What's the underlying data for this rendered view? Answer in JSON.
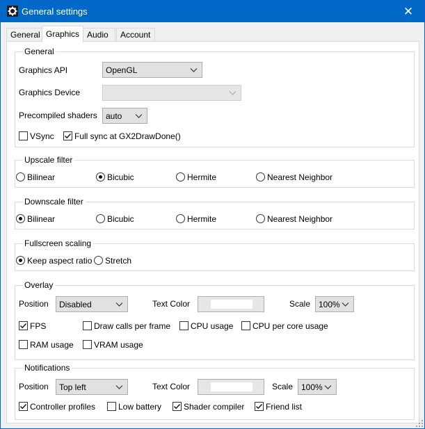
{
  "window": {
    "title": "General settings",
    "app_icon": "gear-icon",
    "close_glyph": "✕"
  },
  "tabs": [
    {
      "label": "General",
      "active": false
    },
    {
      "label": "Graphics",
      "active": true
    },
    {
      "label": "Audio",
      "active": false
    },
    {
      "label": "Account",
      "active": false
    }
  ],
  "general": {
    "title": "General",
    "api_label": "Graphics API",
    "api_value": "OpenGL",
    "device_label": "Graphics Device",
    "device_value": "",
    "shaders_label": "Precompiled shaders",
    "shaders_value": "auto",
    "vsync_label": "VSync",
    "vsync_checked": false,
    "fullsync_label": "Full sync at GX2DrawDone()",
    "fullsync_checked": true
  },
  "upscale": {
    "title": "Upscale filter",
    "options": [
      "Bilinear",
      "Bicubic",
      "Hermite",
      "Nearest Neighbor"
    ],
    "selected": "Bicubic"
  },
  "downscale": {
    "title": "Downscale filter",
    "options": [
      "Bilinear",
      "Bicubic",
      "Hermite",
      "Nearest Neighbor"
    ],
    "selected": "Bilinear"
  },
  "fullscreen": {
    "title": "Fullscreen scaling",
    "options": [
      "Keep aspect ratio",
      "Stretch"
    ],
    "selected": "Keep aspect ratio"
  },
  "overlay": {
    "title": "Overlay",
    "position_label": "Position",
    "position_value": "Disabled",
    "text_color_label": "Text Color",
    "text_color": "#ffffff",
    "scale_label": "Scale",
    "scale_value": "100%",
    "checks": [
      {
        "label": "FPS",
        "checked": true
      },
      {
        "label": "Draw calls per frame",
        "checked": false
      },
      {
        "label": "CPU usage",
        "checked": false
      },
      {
        "label": "CPU per core usage",
        "checked": false
      },
      {
        "label": "RAM usage",
        "checked": false
      },
      {
        "label": "VRAM usage",
        "checked": false
      }
    ]
  },
  "notifications": {
    "title": "Notifications",
    "position_label": "Position",
    "position_value": "Top left",
    "text_color_label": "Text Color",
    "text_color": "#ffffff",
    "scale_label": "Scale",
    "scale_value": "100%",
    "checks": [
      {
        "label": "Controller profiles",
        "checked": true
      },
      {
        "label": "Low battery",
        "checked": false
      },
      {
        "label": "Shader compiler",
        "checked": true
      },
      {
        "label": "Friend list",
        "checked": true
      }
    ]
  },
  "colors": {
    "titlebar": "#0069c8",
    "accent_border": "#0a64c8"
  }
}
